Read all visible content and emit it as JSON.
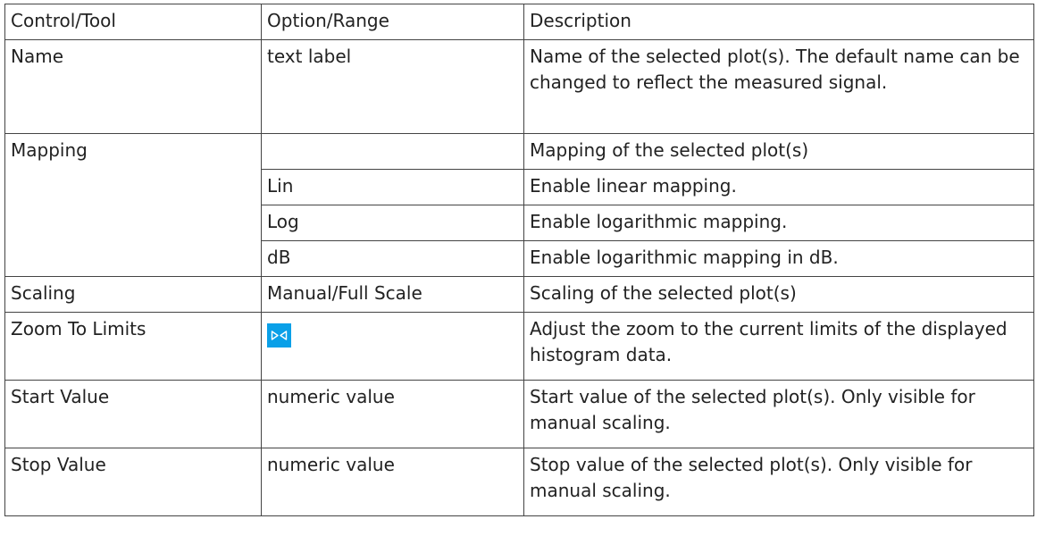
{
  "headers": [
    "Control/Tool",
    "Option/Range",
    "Description"
  ],
  "rows": [
    {
      "control": "Name",
      "option": "text label",
      "description": "Name of the selected plot(s). The default name can be changed to reflect the measured signal."
    },
    {
      "control": "Mapping",
      "option": "",
      "description": "Mapping of the selected plot(s)"
    },
    {
      "control": "",
      "option": "Lin",
      "description": "Enable linear mapping."
    },
    {
      "control": "",
      "option": "Log",
      "description": "Enable logarithmic mapping."
    },
    {
      "control": "",
      "option": "dB",
      "description": "Enable logarithmic mapping in dB."
    },
    {
      "control": "Scaling",
      "option": "Manual/Full Scale",
      "description": "Scaling of the selected plot(s)"
    },
    {
      "control": "Zoom To Limits",
      "option_icon": "zoom-to-limits-icon",
      "description": "Adjust the zoom to the current limits of the displayed histogram data."
    },
    {
      "control": "Start Value",
      "option": "numeric value",
      "description": "Start value of the selected plot(s). Only visible for manual scaling."
    },
    {
      "control": "Stop Value",
      "option": "numeric value",
      "description": "Stop value of the selected plot(s). Only visible for manual scaling."
    }
  ],
  "colors": {
    "icon_background": "#0aa0e8",
    "icon_foreground": "#ffffff",
    "border": "#444444"
  }
}
